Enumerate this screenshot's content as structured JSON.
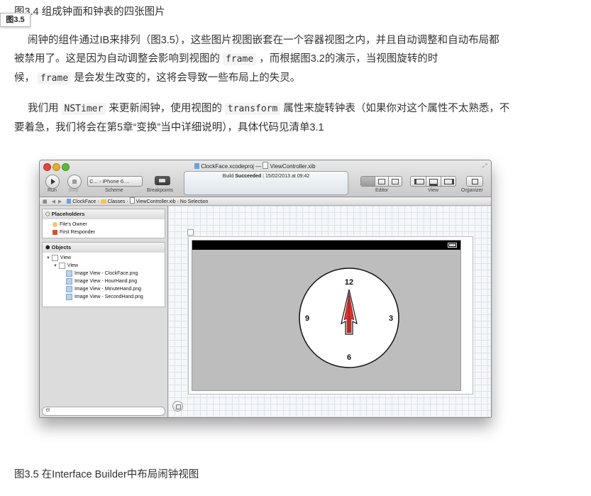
{
  "document": {
    "caption_top": "图3.4 组成钟面和钟表的四张图片",
    "tag_label": "图3.5",
    "paragraph1": {
      "line1": "闹钟的组件通过IB来排列（图3.5），这些图片视图嵌套在一个容器视图之内，并且自动调整和自动布局都",
      "line2_pre": "被禁用了。这是因为自动调整会影响到视图的",
      "line2_code": "frame",
      "line2_post": "，而根据图3.2的演示，当视图旋转的时",
      "line3_pre": "候，",
      "line3_code": "frame",
      "line3_post": "是会发生改变的，这将会导致一些布局上的失灵。"
    },
    "paragraph2": {
      "line1_pre": "我们用",
      "line1_code1": "NSTimer",
      "line1_mid": "来更新闹钟，使用视图的",
      "line1_code2": "transform",
      "line1_post": "属性来旋转钟表（如果你对这个属性不太熟悉，不",
      "line2": "要着急，我们将会在第5章“变换”当中详细说明），具体代码见清单3.1"
    },
    "caption_bottom": "图3.5 在Interface Builder中布局闹钟视图"
  },
  "xcode": {
    "title_project": "ClockFace.xcodeproj",
    "title_sep": "—",
    "title_file": "ViewController.xib",
    "toolbar": {
      "run": "Run",
      "stop": "Stop",
      "scheme": "Scheme",
      "scheme_value": "C...",
      "device_value": "iPhone 6....",
      "breakpoints": "Breakpoints",
      "editor": "Editor",
      "view": "View",
      "organizer": "Organizer"
    },
    "status": {
      "build_prefix": "Build",
      "build_result": "Succeeded",
      "separator": "|",
      "date": "15/02/2013 at 09:42"
    },
    "jumpbar": {
      "project": "ClockFace",
      "folder": "Classes",
      "file": "ViewController.xib",
      "selection": "No Selection"
    },
    "placeholders": {
      "header": "Placeholders",
      "items": [
        "File's Owner",
        "First Responder"
      ]
    },
    "objects": {
      "header": "Objects",
      "view": "View",
      "subview": "View",
      "images": [
        "Image View - ClockFace.png",
        "Image View - HourHand.png",
        "Image View - MinuteHand.png",
        "Image View - SecondHand.png"
      ]
    },
    "clock": {
      "n12": "12",
      "n3": "3",
      "n6": "6",
      "n9": "9"
    },
    "colors": {
      "hand_fill": "#d8322f",
      "canvas_bg": "#bdbdbd"
    }
  }
}
